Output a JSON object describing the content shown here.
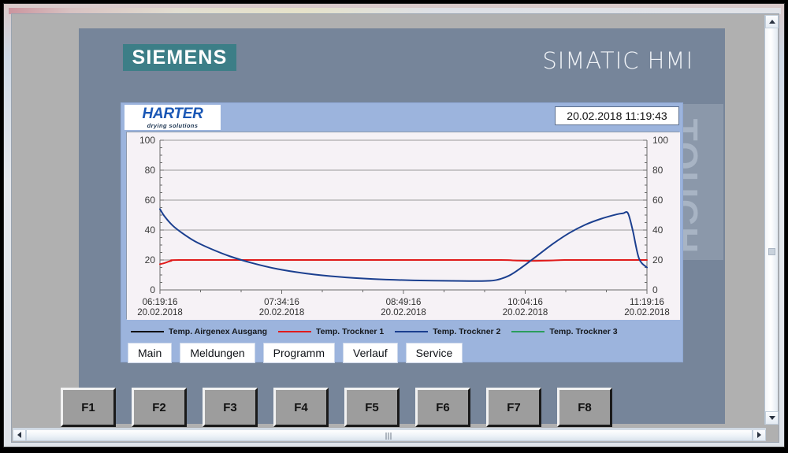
{
  "window": {
    "vscroll_up_icon": "chevron-up-icon",
    "vscroll_down_icon": "chevron-down-icon",
    "hscroll_left_icon": "chevron-left-icon",
    "hscroll_right_icon": "chevron-right-icon"
  },
  "device": {
    "brand_label": "SIEMENS",
    "product_label": "SIMATIC HMI",
    "touch_label": "TOUCH",
    "brand_color": "#3c7e87",
    "bezel_color": "#76859a"
  },
  "app": {
    "logo": {
      "brand": "HARTER",
      "tagline": "drying solutions",
      "brand_color": "#1a57b5"
    },
    "datetime": "20.02.2018 11:19:43",
    "background_color": "#9cb4dd"
  },
  "nav": {
    "buttons": [
      {
        "label": "Main"
      },
      {
        "label": "Meldungen"
      },
      {
        "label": "Programm"
      },
      {
        "label": "Verlauf"
      },
      {
        "label": "Service"
      }
    ]
  },
  "function_keys": [
    {
      "label": "F1"
    },
    {
      "label": "F2"
    },
    {
      "label": "F3"
    },
    {
      "label": "F4"
    },
    {
      "label": "F5"
    },
    {
      "label": "F6"
    },
    {
      "label": "F7"
    },
    {
      "label": "F8"
    }
  ],
  "chart_data": {
    "type": "line",
    "title": "",
    "xlabel": "",
    "ylabel": "",
    "ylim": [
      0,
      100
    ],
    "y_ticks": [
      0,
      20,
      40,
      60,
      80,
      100
    ],
    "y_axis_right": true,
    "y_ticks_right": [
      0,
      20,
      40,
      60,
      80,
      100
    ],
    "grid": true,
    "legend_position": "bottom",
    "plot_background": "#f6f2f6",
    "x_tick_labels": [
      {
        "time": "06:19:16",
        "date": "20.02.2018"
      },
      {
        "time": "07:34:16",
        "date": "20.02.2018"
      },
      {
        "time": "08:49:16",
        "date": "20.02.2018"
      },
      {
        "time": "10:04:16",
        "date": "20.02.2018"
      },
      {
        "time": "11:19:16",
        "date": "20.02.2018"
      }
    ],
    "x_range_minutes": [
      0,
      307
    ],
    "series": [
      {
        "name": "Temp. Airgenex Ausgang",
        "color": "#111111",
        "values": []
      },
      {
        "name": "Temp. Trockner 1",
        "color": "#e01b1b",
        "x": [
          0,
          3,
          7,
          12,
          60,
          120,
          180,
          215,
          225,
          235,
          245,
          255,
          265,
          280,
          300,
          307
        ],
        "values": [
          17.2,
          18.0,
          19.4,
          20.0,
          20.0,
          20.0,
          20.0,
          20.0,
          19.6,
          19.4,
          19.6,
          20.0,
          20.0,
          20.0,
          20.0,
          20.0
        ]
      },
      {
        "name": "Temp. Trockner 2",
        "color": "#1b3f8f",
        "x": [
          0,
          3,
          8,
          14,
          22,
          32,
          44,
          58,
          74,
          92,
          112,
          134,
          160,
          190,
          205,
          212,
          220,
          228,
          238,
          248,
          258,
          268,
          278,
          288,
          292,
          295,
          298,
          302,
          307
        ],
        "values": [
          54.0,
          49.0,
          43.0,
          38.0,
          32.5,
          27.5,
          22.5,
          18.0,
          14.0,
          11.0,
          8.8,
          7.3,
          6.4,
          6.0,
          6.0,
          6.6,
          9.5,
          15.0,
          23.0,
          31.0,
          38.0,
          43.5,
          47.5,
          50.5,
          51.2,
          51.3,
          40.0,
          21.0,
          15.0
        ]
      },
      {
        "name": "Temp. Trockner 3",
        "color": "#2a9d5c",
        "values": []
      }
    ]
  }
}
